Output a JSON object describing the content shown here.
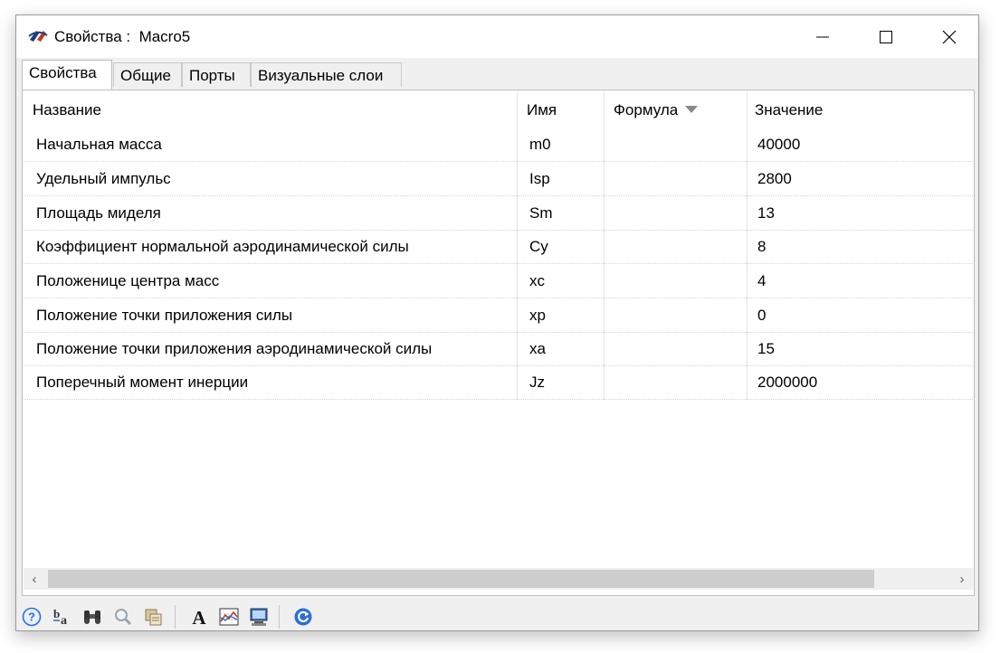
{
  "window": {
    "title": "Свойства :",
    "object_name": "Macro5"
  },
  "tabs": [
    {
      "label": "Свойства",
      "active": true
    },
    {
      "label": "Общие",
      "active": false
    },
    {
      "label": "Порты",
      "active": false
    },
    {
      "label": "Визуальные слои",
      "active": false
    }
  ],
  "table": {
    "columns": [
      "Название",
      "Имя",
      "Формула",
      "Значение"
    ],
    "sorted_column": "Формула",
    "rows": [
      {
        "name": "Начальная масса",
        "id": "m0",
        "formula": "",
        "value": "40000"
      },
      {
        "name": "Удельный импульс",
        "id": "Isp",
        "formula": "",
        "value": "2800"
      },
      {
        "name": "Площадь миделя",
        "id": "Sm",
        "formula": "",
        "value": "13"
      },
      {
        "name": "Коэффициент нормальной аэродинамической силы",
        "id": "Cy",
        "formula": "",
        "value": "8"
      },
      {
        "name": "Положеницe центра масс",
        "id": "xc",
        "formula": "",
        "value": "4"
      },
      {
        "name": "Положение точки приложения силы",
        "id": "xp",
        "formula": "",
        "value": "0"
      },
      {
        "name": "Положение точки приложения аэродинамической силы",
        "id": "xa",
        "formula": "",
        "value": "15"
      },
      {
        "name": "Поперечный момент инерции",
        "id": "Jz",
        "formula": "",
        "value": "2000000"
      }
    ]
  },
  "scrollbar": {
    "left_arrow": "‹",
    "right_arrow": "›"
  },
  "toolbar": {
    "buttons": [
      "help-icon",
      "sort-ba-icon",
      "binoculars-icon",
      "magnifier-icon",
      "copy-props-icon",
      "font-icon",
      "chart-icon",
      "computer-icon",
      "refresh-icon"
    ],
    "font_glyph": "A",
    "sort_glyph_b": "b",
    "sort_glyph_a": "a",
    "help_glyph": "?"
  },
  "colors": {
    "accent_blue": "#2a6fd6",
    "grid_line": "#e4e4e4",
    "scroll_thumb": "#cdcdcd"
  }
}
